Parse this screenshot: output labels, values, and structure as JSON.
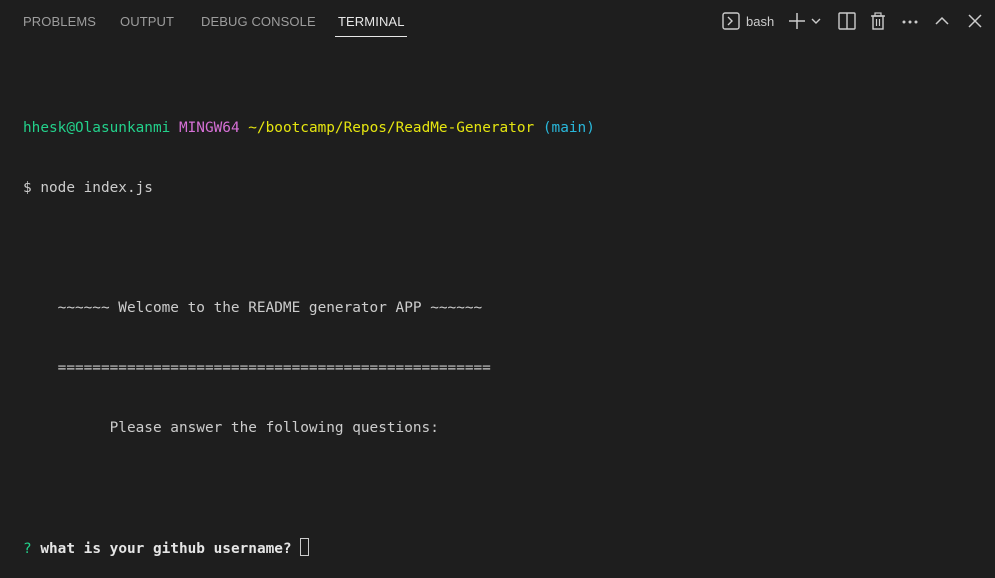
{
  "tabs": [
    {
      "label": "PROBLEMS"
    },
    {
      "label": "OUTPUT"
    },
    {
      "label": "DEBUG CONSOLE"
    },
    {
      "label": "TERMINAL"
    }
  ],
  "toolbar": {
    "shell_label": "bash"
  },
  "terminal": {
    "prompt_user": "hhesk@Olasunkanmi",
    "prompt_env": "MINGW64",
    "prompt_path": "~/bootcamp/Repos/ReadMe-Generator",
    "prompt_branch": "(main)",
    "command_line": "$ node index.js",
    "welcome_line": "    ~~~~~~ Welcome to the README generator APP ~~~~~~",
    "separator_line": "    ==================================================",
    "instruction_line": "          Please answer the following questions:",
    "question_mark": "?",
    "question_text": "what is your github username?"
  },
  "colors": {
    "background": "#1e1e1e",
    "user": "#23d18b",
    "env": "#d670d6",
    "path": "#e5e510",
    "branch": "#29b8db"
  },
  "icons": [
    "terminal-icon",
    "plus-icon",
    "chevron-down-icon",
    "split-icon",
    "trash-icon",
    "more-icon",
    "chevron-up-icon",
    "close-icon"
  ]
}
